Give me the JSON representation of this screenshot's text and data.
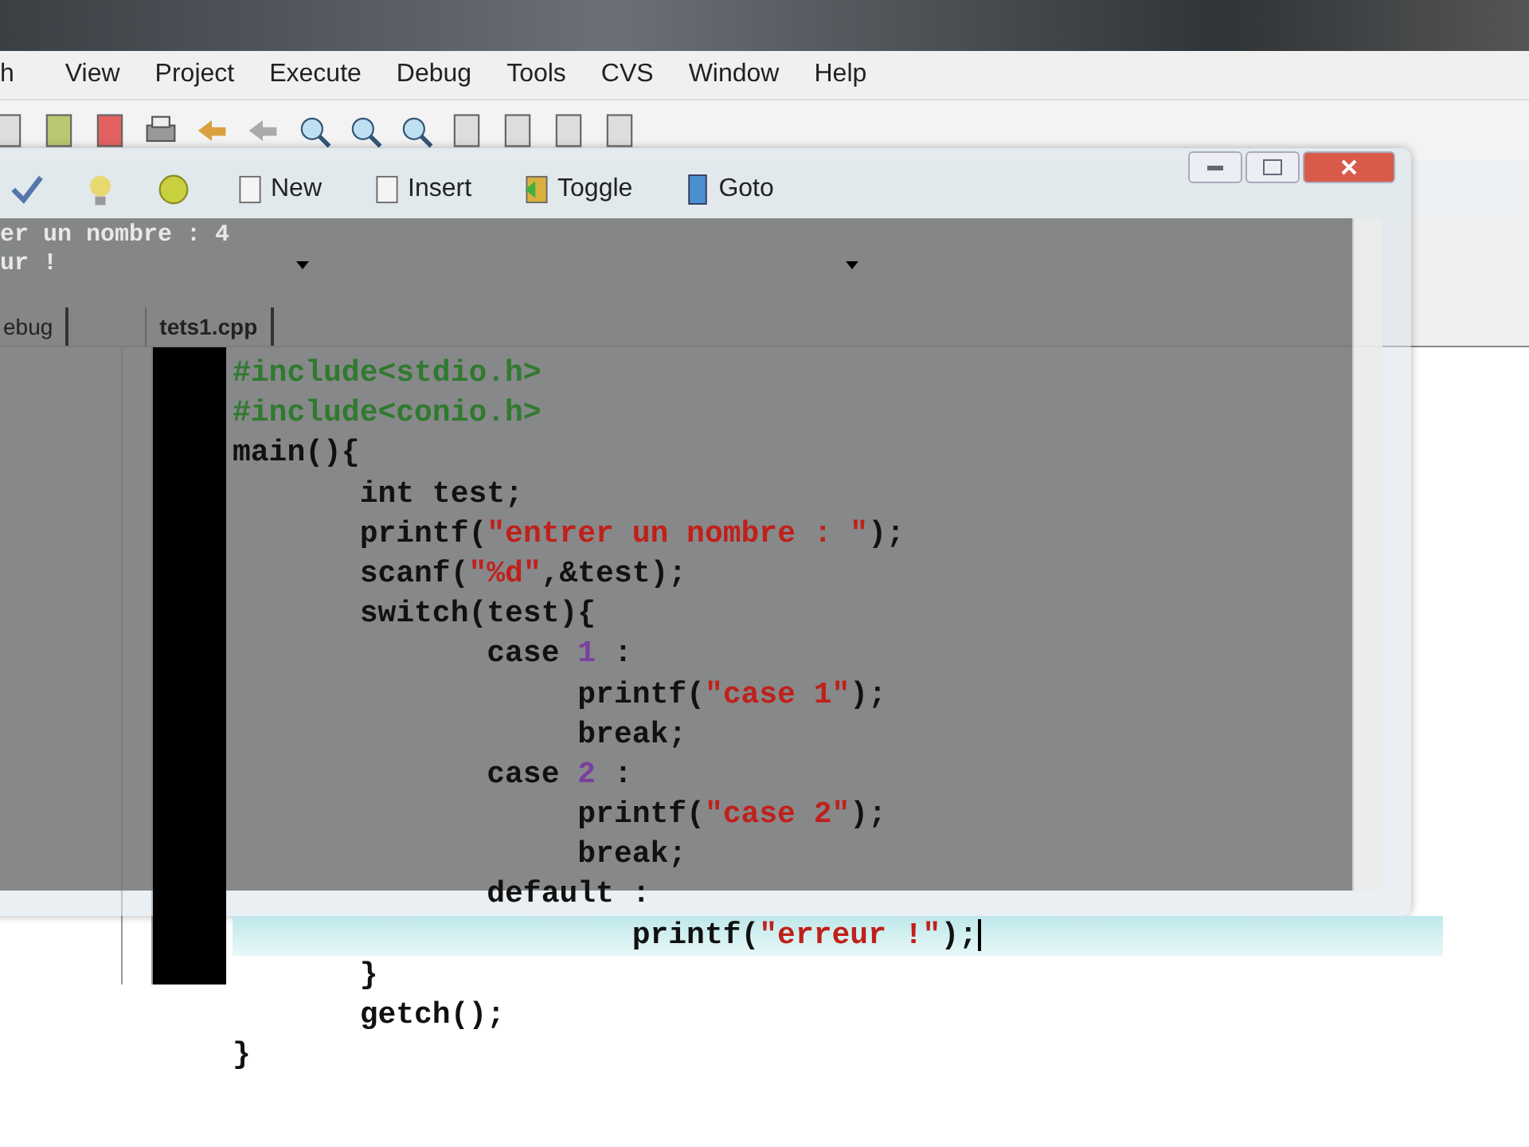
{
  "menu": [
    "h",
    "View",
    "Project",
    "Execute",
    "Debug",
    "Tools",
    "CVS",
    "Window",
    "Help"
  ],
  "toolbar_buttons": [
    "New",
    "Insert",
    "Toggle",
    "Goto"
  ],
  "tabs": [
    {
      "label": "ebug",
      "selected": false
    },
    {
      "label": "tets1.cpp",
      "selected": true
    }
  ],
  "editor": {
    "lines": [
      {
        "current": false,
        "tokens": [
          {
            "kind": "preproc",
            "text": "#include<stdio.h>"
          }
        ]
      },
      {
        "current": false,
        "tokens": [
          {
            "kind": "preproc",
            "text": "#include<conio.h>"
          }
        ]
      },
      {
        "current": false,
        "tokens": [
          {
            "kind": "plain",
            "text": "main(){"
          }
        ]
      },
      {
        "current": false,
        "tokens": [
          {
            "kind": "plain",
            "text": "       int test;"
          }
        ]
      },
      {
        "current": false,
        "tokens": [
          {
            "kind": "plain",
            "text": "       printf("
          },
          {
            "kind": "string",
            "text": "\"entrer un nombre : \""
          },
          {
            "kind": "plain",
            "text": ");"
          }
        ]
      },
      {
        "current": false,
        "tokens": [
          {
            "kind": "plain",
            "text": "       scanf("
          },
          {
            "kind": "string",
            "text": "\"%d\""
          },
          {
            "kind": "plain",
            "text": ",&test);"
          }
        ]
      },
      {
        "current": false,
        "tokens": [
          {
            "kind": "plain",
            "text": "       switch(test){"
          }
        ]
      },
      {
        "current": false,
        "tokens": [
          {
            "kind": "plain",
            "text": "              case "
          },
          {
            "kind": "number",
            "text": "1"
          },
          {
            "kind": "plain",
            "text": " :"
          }
        ]
      },
      {
        "current": false,
        "tokens": [
          {
            "kind": "plain",
            "text": "                   printf("
          },
          {
            "kind": "string",
            "text": "\"case 1\""
          },
          {
            "kind": "plain",
            "text": ");"
          }
        ]
      },
      {
        "current": false,
        "tokens": [
          {
            "kind": "plain",
            "text": "                   break;"
          }
        ]
      },
      {
        "current": false,
        "tokens": [
          {
            "kind": "plain",
            "text": "              case "
          },
          {
            "kind": "number",
            "text": "2"
          },
          {
            "kind": "plain",
            "text": " :"
          }
        ]
      },
      {
        "current": false,
        "tokens": [
          {
            "kind": "plain",
            "text": "                   printf("
          },
          {
            "kind": "string",
            "text": "\"case 2\""
          },
          {
            "kind": "plain",
            "text": ");"
          }
        ]
      },
      {
        "current": false,
        "tokens": [
          {
            "kind": "plain",
            "text": "                   break;"
          }
        ]
      },
      {
        "current": false,
        "tokens": [
          {
            "kind": "plain",
            "text": "              default :"
          }
        ]
      },
      {
        "current": true,
        "tokens": [
          {
            "kind": "plain",
            "text": "                      printf("
          },
          {
            "kind": "string",
            "text": "\"erreur !\""
          },
          {
            "kind": "plain",
            "text": ");"
          }
        ]
      },
      {
        "current": false,
        "tokens": [
          {
            "kind": "plain",
            "text": "       }"
          }
        ]
      },
      {
        "current": false,
        "tokens": [
          {
            "kind": "plain",
            "text": "       getch();"
          }
        ]
      },
      {
        "current": false,
        "tokens": [
          {
            "kind": "plain",
            "text": "}"
          }
        ]
      }
    ]
  },
  "console": {
    "lines": [
      "er un nombre : 4",
      "ur !"
    ]
  }
}
